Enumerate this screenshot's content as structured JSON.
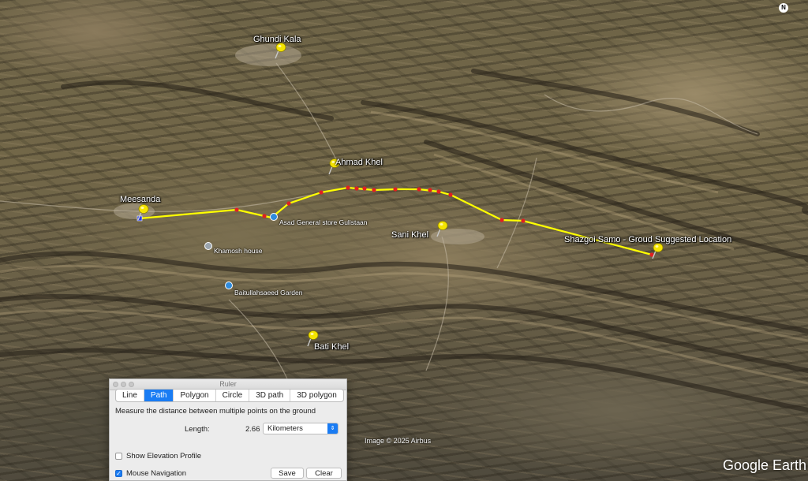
{
  "map": {
    "attribution": "Image © 2025 Airbus",
    "brand": "Google Earth",
    "compass": "N",
    "placemarks": [
      {
        "label": "Ghundi Kala"
      },
      {
        "label": "Ahmad Khel"
      },
      {
        "label": "Meesanda"
      },
      {
        "label": "Sani Khel"
      },
      {
        "label": "Shazgoi Samo - Groud Suggested Location"
      },
      {
        "label": "Bati Khel"
      }
    ],
    "pois": [
      {
        "label": "Asad General store Gulistaan",
        "icon": "blue-poi-icon",
        "color": "#2f8bdc"
      },
      {
        "label": "Khamosh house",
        "icon": "gray-poi-icon",
        "color": "#9aa4ad"
      },
      {
        "label": "Baitullahsaeed Garden",
        "icon": "blue-poi-icon",
        "color": "#2f8bdc"
      }
    ],
    "path_color": "#ffff00",
    "vertex_color": "#e02020"
  },
  "ruler": {
    "title": "Ruler",
    "tabs": [
      "Line",
      "Path",
      "Polygon",
      "Circle",
      "3D path",
      "3D polygon"
    ],
    "active_tab": "Path",
    "description": "Measure the distance between multiple points on the ground",
    "length_label": "Length:",
    "length_value": "2.66",
    "unit": "Kilometers",
    "show_elevation_label": "Show Elevation Profile",
    "show_elevation_checked": false,
    "mouse_nav_label": "Mouse Navigation",
    "mouse_nav_checked": true,
    "save_label": "Save",
    "clear_label": "Clear"
  }
}
